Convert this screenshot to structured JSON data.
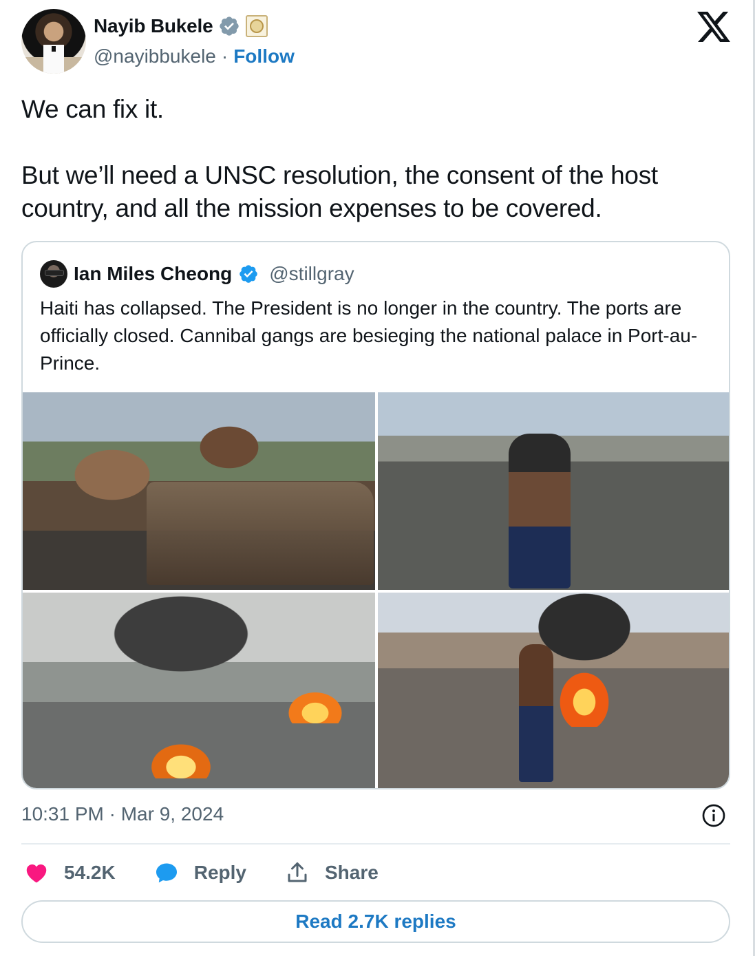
{
  "author": {
    "name": "Nayib Bukele",
    "handle": "@nayibbukele",
    "separator": "·",
    "follow_label": "Follow",
    "icons": [
      "verified-badge-icon",
      "government-seal-icon"
    ]
  },
  "platform_logo": "x-logo-icon",
  "tweet": {
    "paragraphs": [
      "We can fix it.",
      "But we’ll need a UNSC resolution, the consent of the host country, and all the mission expenses to be covered."
    ]
  },
  "quote": {
    "name": "Ian Miles Cheong",
    "handle": "@stillgray",
    "text": "Haiti has collapsed. The President is no longer in the country. The ports are officially closed. Cannibal gangs are besieging the national palace in Port-au-Prince.",
    "images": [
      "photo-crowd-on-burned-car",
      "photo-man-with-stick-street",
      "photo-burning-tires-smoke",
      "photo-boy-near-fire"
    ]
  },
  "timestamp": "10:31 PM · Mar 9, 2024",
  "actions": {
    "likes": "54.2K",
    "reply_label": "Reply",
    "share_label": "Share"
  },
  "read_replies_label": "Read 2.7K replies",
  "colors": {
    "accent": "#1d79c3",
    "like": "#f91880",
    "reply_icon": "#1d9bf0",
    "muted": "#536471"
  }
}
